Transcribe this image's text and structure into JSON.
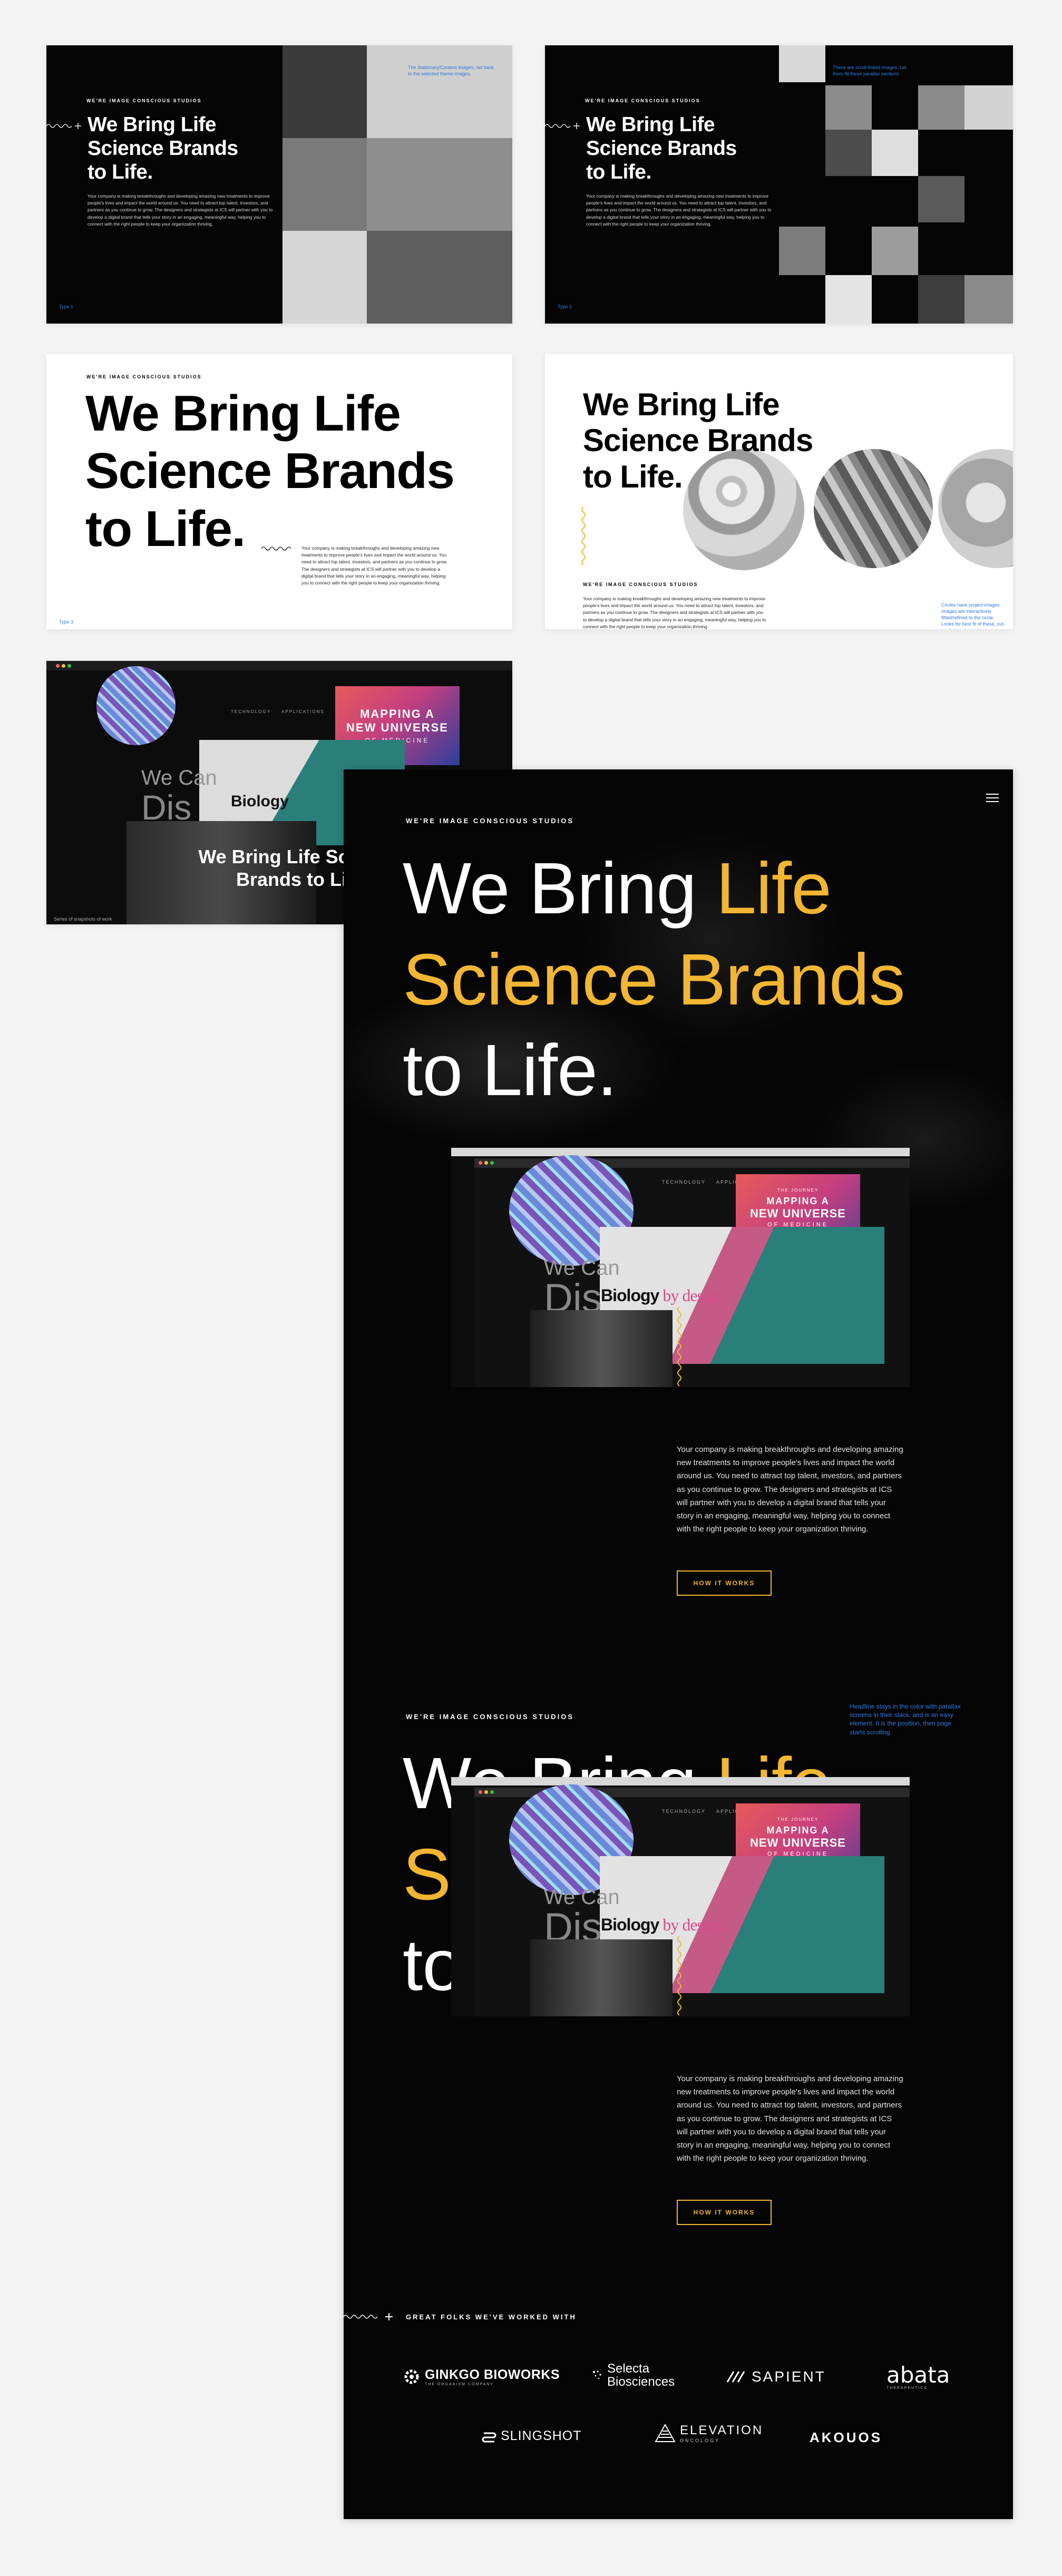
{
  "shared": {
    "eyebrow": "WE'RE IMAGE CONSCIOUS STUDIOS",
    "headline_l1": "We Bring Life",
    "headline_l2": "Science Brands",
    "headline_l3": "to Life.",
    "body": "Your company is making breakthroughs and developing amazing new treatments to improve people's lives and impact the world around us. You need to attract top talent, investors, and partners as you continue to grow. The designers and strategists at ICS will partner with you to develop a digital brand that tells your story in an engaging, meaningful way, helping you to connect with the right people to keep your organization thriving.",
    "type_label": "Type 1",
    "type_label_2": "Type 2",
    "type_label_3": "Type 3",
    "note_1": "The Stationary/Content images, set back to the selected theme images.",
    "note_2": "These are scroll-linked images. Let them fill these parallax sections.",
    "note_3": "Circles have project images. Images are interactively fitted/refined to the circle. Looks for best fit of these, cut-out fade point.",
    "note_4": "Series of snapshots of work",
    "note_5": "Headline stays in the color with parallax screens in their stack, and is an easy element. It is the position, then page starts scrolling."
  },
  "main": {
    "eyebrow": "WE'RE IMAGE CONSCIOUS STUDIOS",
    "line1_white": "We Bring ",
    "line1_gold": "Life",
    "line2_gold": "Science Brands",
    "line3_white": "to Life.",
    "cta": "HOW IT WORKS",
    "partners_title": "GREAT FOLKS WE'VE WORKED WITH",
    "menu_icon": "hamburger-icon"
  },
  "mockup": {
    "nav_1": "TECHNOLOGY",
    "nav_2": "APPLICATIONS",
    "poster_kicker": "THE JOURNEY",
    "poster_l1": "MAPPING A",
    "poster_l2": "NEW UNIVERSE",
    "poster_l3": "OF MEDICINE",
    "biology_1": "Biology",
    "biology_2": " by design.",
    "we_can": "We Can",
    "dis": "Dis"
  },
  "partners": [
    {
      "name": "GINKGO BIOWORKS",
      "sub": "THE ORGANISM COMPANY",
      "icon": "ginkgo-gear-icon"
    },
    {
      "name": "Selecta",
      "sub": "Biosciences",
      "icon": "selecta-dots-icon"
    },
    {
      "name": "SAPIENT",
      "sub": "",
      "icon": "sapient-slashes-icon"
    },
    {
      "name": "abata",
      "sub": "THERAPEUTICS",
      "icon": ""
    },
    {
      "name": "SLINGSHOT",
      "sub": "",
      "icon": "slingshot-icon"
    },
    {
      "name": "ELEVATION",
      "sub": "ONCOLOGY",
      "icon": "elevation-icon"
    },
    {
      "name": "AKOUOS",
      "sub": "",
      "icon": ""
    }
  ],
  "colors": {
    "accent": "#f2b632",
    "note": "#2f7be0",
    "bg": "#050505"
  }
}
